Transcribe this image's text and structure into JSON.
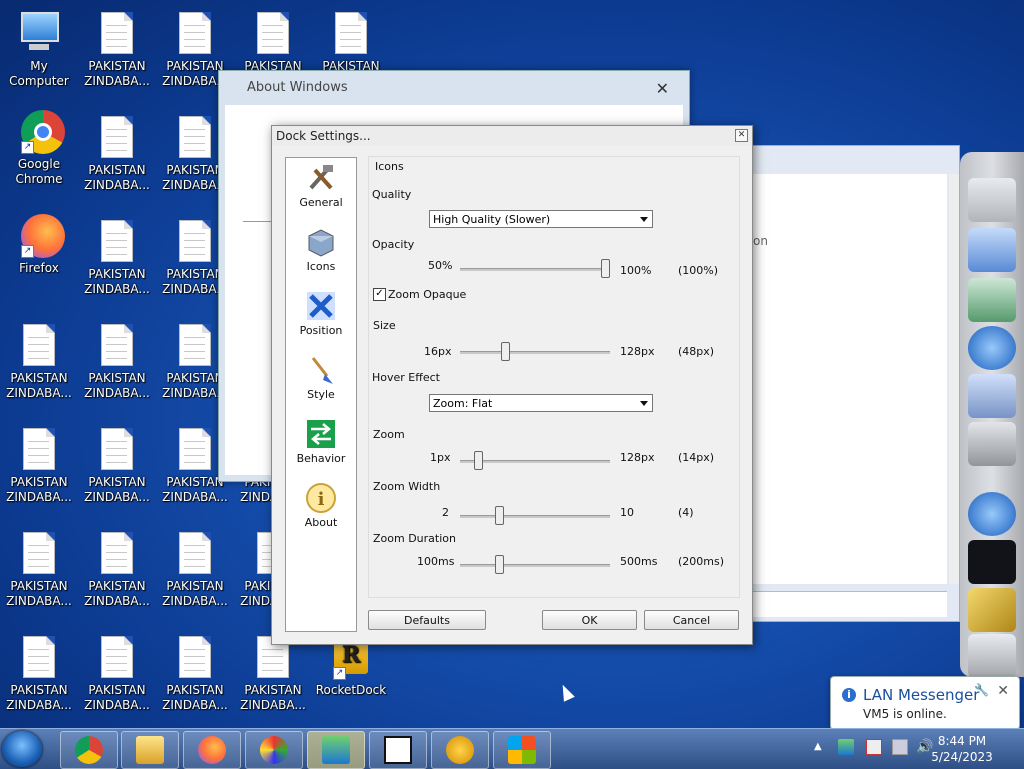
{
  "desktop": {
    "icons": [
      {
        "label": "My Computer",
        "kind": "computer"
      },
      {
        "label": "Google Chrome",
        "kind": "chrome"
      },
      {
        "label": "Firefox",
        "kind": "firefox"
      },
      {
        "label": "PAKISTAN ZINDABA...",
        "kind": "doc"
      },
      {
        "label": "RocketDock",
        "kind": "rocketdock"
      }
    ],
    "doc_label": "PAKISTAN ZINDABA...",
    "doc_label_top_row": "PAKISTAN ZINDABA...",
    "top_row_partial": "PAKISTAN"
  },
  "about_window": {
    "title": "About Windows",
    "close_glyph": "✕"
  },
  "right_window": {
    "partial_text": "on"
  },
  "dock_settings": {
    "title": "Dock Settings...",
    "close_glyph": "✕",
    "sidebar": [
      "General",
      "Icons",
      "Position",
      "Style",
      "Behavior",
      "About"
    ],
    "panel_heading": "Icons",
    "quality": {
      "label": "Quality",
      "value": "High Quality (Slower)"
    },
    "opacity": {
      "label": "Opacity",
      "min": "50%",
      "max": "100%",
      "current": "(100%)",
      "level": 1.0
    },
    "zoom_opaque": {
      "label": "Zoom Opaque",
      "checked": true,
      "mark": "✓"
    },
    "size": {
      "label": "Size",
      "min": "16px",
      "max": "128px",
      "current": "(48px)",
      "level": 0.29
    },
    "hover_effect": {
      "label": "Hover Effect",
      "value": "Zoom: Flat"
    },
    "zoom": {
      "label": "Zoom",
      "min": "1px",
      "max": "128px",
      "current": "(14px)",
      "level": 0.1
    },
    "zoom_width": {
      "label": "Zoom Width",
      "min": "2",
      "max": "10",
      "current": "(4)",
      "level": 0.25
    },
    "zoom_duration": {
      "label": "Zoom Duration",
      "min": "100ms",
      "max": "500ms",
      "current": "(200ms)",
      "level": 0.25
    },
    "buttons": {
      "defaults": "Defaults",
      "ok": "OK",
      "cancel": "Cancel"
    }
  },
  "notification": {
    "title": "LAN Messenger",
    "message": "VM5 is online.",
    "close_glyph": "✕",
    "pin_glyph": "🔧",
    "info_glyph": "i"
  },
  "taskbar": {
    "clock_time": "8:44 PM",
    "clock_date": "5/24/2023",
    "pinned": [
      "chrome",
      "explorer",
      "firefox",
      "paint",
      "messenger",
      "7zip",
      "bitcoin",
      "windows"
    ]
  },
  "colors": {
    "desktop": "#1650b0",
    "accent": "#2a6fd0"
  }
}
